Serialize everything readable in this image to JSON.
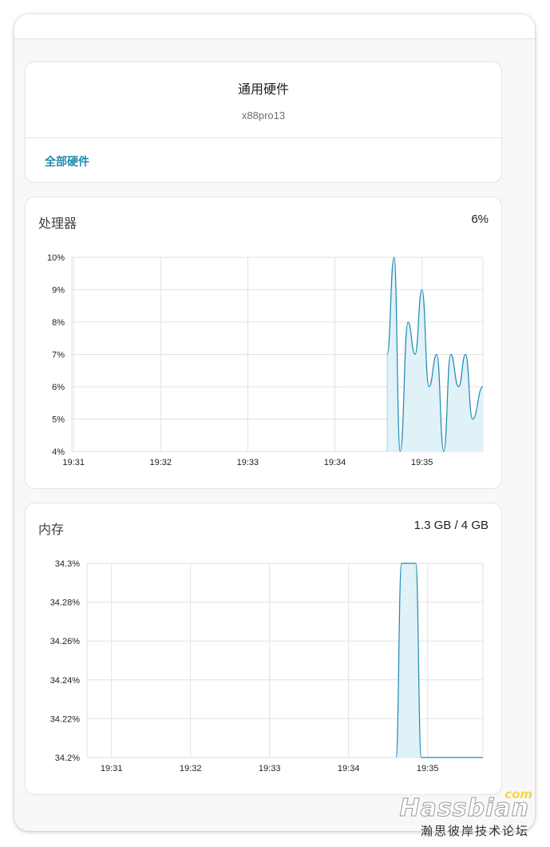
{
  "device": {
    "title": "通用硬件",
    "subtitle": "x88pro13",
    "link_label": "全部硬件"
  },
  "cpu": {
    "title": "处理器",
    "value": "6%"
  },
  "memory": {
    "title": "内存",
    "value": "1.3 GB / 4 GB"
  },
  "watermark": {
    "logo": "Hassbian",
    "suffix": "com",
    "caption": "瀚思彼岸技术论坛"
  },
  "colors": {
    "accent": "#1e8ab0",
    "line": "#1e8ab0",
    "fill": "#e0f1f8",
    "grid": "#e2e2e2"
  },
  "chart_data": [
    {
      "type": "area",
      "series_key": "cpu",
      "y_ticks": [
        "10%",
        "9%",
        "8%",
        "7%",
        "6%",
        "5%",
        "4%"
      ],
      "ylim": [
        4,
        10
      ],
      "x_ticks": [
        "19:31",
        "19:32",
        "19:33",
        "19:34",
        "19:35"
      ],
      "x_tick_minutes": [
        31,
        32,
        33,
        34,
        35
      ],
      "xlim_minutes": [
        30.98,
        35.7
      ],
      "grid": true,
      "series": [
        {
          "x_minutes": [
            34.6,
            34.68,
            34.75,
            34.84,
            34.92,
            35.0,
            35.08,
            35.17,
            35.25,
            35.33,
            35.42,
            35.5,
            35.58,
            35.7
          ],
          "values": [
            7,
            10,
            4,
            8,
            7,
            9,
            6,
            7,
            4,
            7,
            6,
            7,
            5,
            6
          ]
        }
      ]
    },
    {
      "type": "area",
      "series_key": "memory",
      "y_ticks": [
        "34.3%",
        "34.28%",
        "34.26%",
        "34.24%",
        "34.22%",
        "34.2%"
      ],
      "ylim": [
        34.2,
        34.3
      ],
      "x_ticks": [
        "19:31",
        "19:32",
        "19:33",
        "19:34",
        "19:35"
      ],
      "x_tick_minutes": [
        31,
        32,
        33,
        34,
        35
      ],
      "xlim_minutes": [
        30.69,
        35.7
      ],
      "grid": true,
      "series": [
        {
          "x_minutes": [
            34.6,
            34.67,
            34.85,
            34.92,
            35.7
          ],
          "values": [
            34.2,
            34.3,
            34.3,
            34.2,
            34.2
          ]
        }
      ]
    }
  ]
}
